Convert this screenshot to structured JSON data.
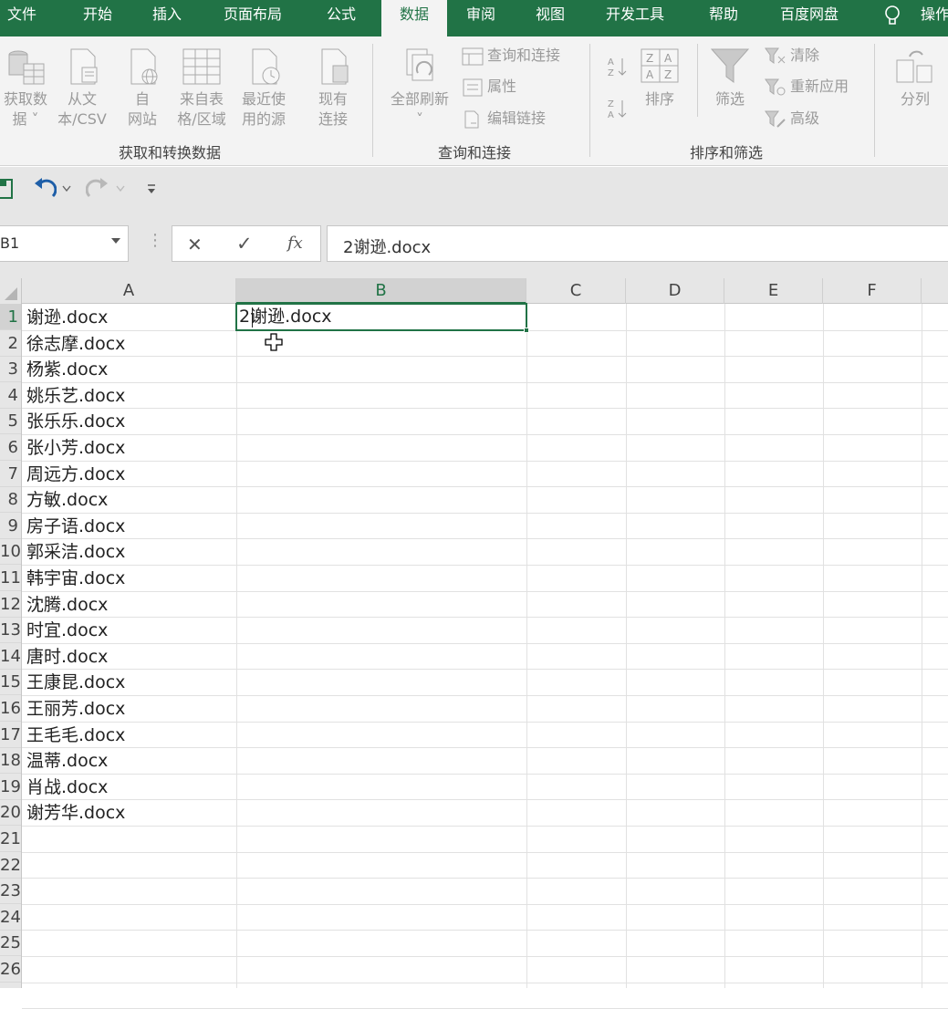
{
  "ribbon_tabs": [
    {
      "label": "文件"
    },
    {
      "label": "开始"
    },
    {
      "label": "插入"
    },
    {
      "label": "页面布局"
    },
    {
      "label": "公式"
    },
    {
      "label": "数据"
    },
    {
      "label": "审阅"
    },
    {
      "label": "视图"
    },
    {
      "label": "开发工具"
    },
    {
      "label": "帮助"
    },
    {
      "label": "百度网盘"
    },
    {
      "label": "操作"
    }
  ],
  "active_tab": "数据",
  "ribbon": {
    "get_data": {
      "line1": "获取数",
      "line2": "据 ˅"
    },
    "from_text": {
      "line1": "从文",
      "line2": "本/CSV"
    },
    "from_web": {
      "line1": "自",
      "line2": "网站"
    },
    "from_table": {
      "line1": "来自表",
      "line2": "格/区域"
    },
    "recent_sources": {
      "line1": "最近使",
      "line2": "用的源"
    },
    "existing_conn": {
      "line1": "现有",
      "line2": "连接"
    },
    "group1_label": "获取和转换数据",
    "refresh_all": {
      "line1": "全部刷新",
      "line2": "˅"
    },
    "queries_conn": "查询和连接",
    "properties": "属性",
    "edit_links": "编辑链接",
    "group2_label": "查询和连接",
    "sort": "排序",
    "filter": "筛选",
    "clear": "清除",
    "reapply": "重新应用",
    "advanced": "高级",
    "group3_label": "排序和筛选",
    "text_to_columns": "分列"
  },
  "formula_bar": {
    "name_box": "B1",
    "cancel": "✕",
    "enter": "✓",
    "fx": "fx",
    "content": "2谢逊.docx"
  },
  "columns": [
    {
      "label": "A"
    },
    {
      "label": "B"
    },
    {
      "label": "C"
    },
    {
      "label": "D"
    },
    {
      "label": "E"
    },
    {
      "label": "F"
    }
  ],
  "row_numbers": [
    "1",
    "2",
    "3",
    "4",
    "5",
    "6",
    "7",
    "8",
    "9",
    "10",
    "11",
    "12",
    "13",
    "14",
    "15",
    "16",
    "17",
    "18",
    "19",
    "20",
    "21",
    "22",
    "23",
    "24",
    "25",
    "26"
  ],
  "column_a": [
    "谢逊.docx",
    "徐志摩.docx",
    "杨紫.docx",
    "姚乐艺.docx",
    "张乐乐.docx",
    "张小芳.docx",
    "周远方.docx",
    "方敏.docx",
    "房子语.docx",
    "郭采洁.docx",
    "韩宇宙.docx",
    "沈腾.docx",
    "时宜.docx",
    "唐时.docx",
    "王康昆.docx",
    "王丽芳.docx",
    "王毛毛.docx",
    "温蒂.docx",
    "肖战.docx",
    "谢芳华.docx"
  ],
  "cell_b1": "2谢逊.docx",
  "colors": {
    "accent": "#217346",
    "ribbon_bg": "#f3f3f3",
    "header_bg": "#e6e6e6"
  }
}
